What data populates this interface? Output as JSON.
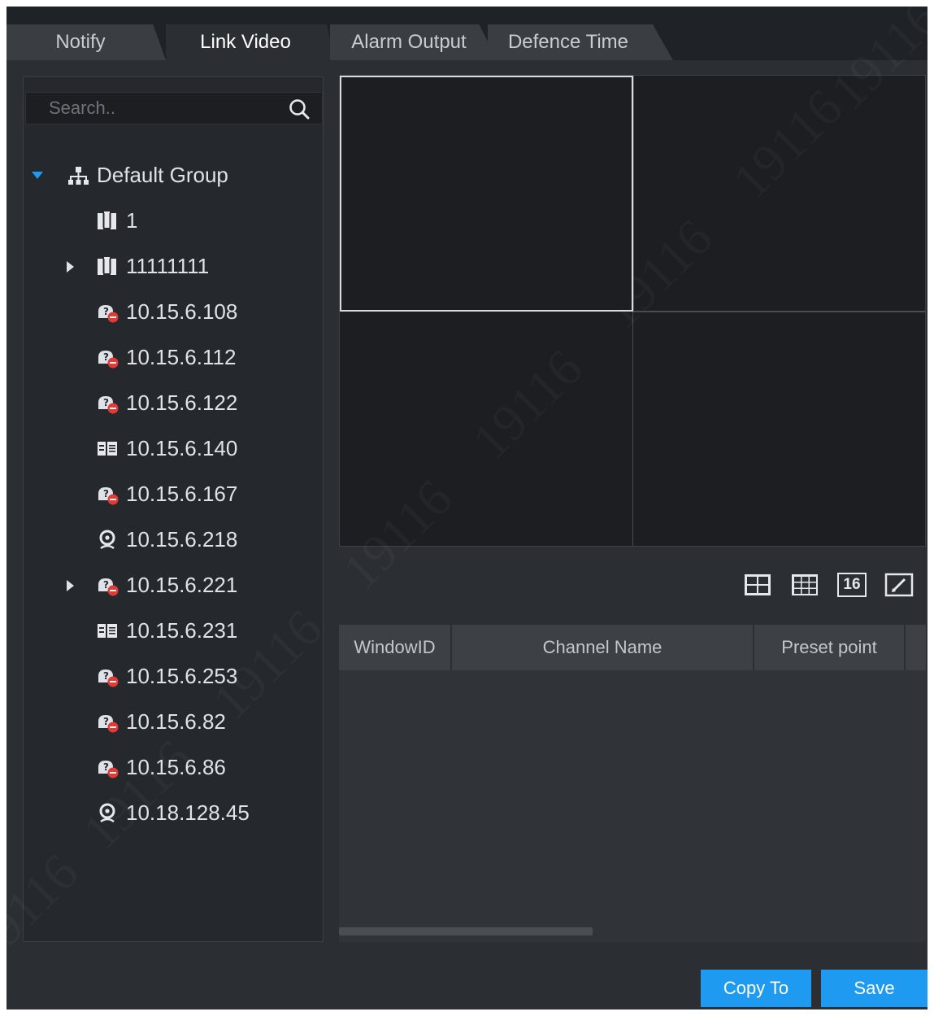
{
  "tabs": [
    {
      "label": "Notify",
      "active": false
    },
    {
      "label": "Link Video",
      "active": true
    },
    {
      "label": "Alarm Output",
      "active": false
    },
    {
      "label": "Defence Time",
      "active": false
    }
  ],
  "search": {
    "placeholder": "Search.."
  },
  "tree": {
    "group": {
      "label": "Default Group",
      "expanded": true,
      "icon": "group-icon"
    },
    "items": [
      {
        "label": "1",
        "icon": "map-icon",
        "has_children": false
      },
      {
        "label": "11111111",
        "icon": "map-icon",
        "has_children": true
      },
      {
        "label": "10.15.6.108",
        "icon": "offline-device-icon",
        "has_children": false
      },
      {
        "label": "10.15.6.112",
        "icon": "offline-device-icon",
        "has_children": false
      },
      {
        "label": "10.15.6.122",
        "icon": "offline-device-icon",
        "has_children": false
      },
      {
        "label": "10.15.6.140",
        "icon": "nvr-icon",
        "has_children": false
      },
      {
        "label": "10.15.6.167",
        "icon": "offline-device-icon",
        "has_children": false
      },
      {
        "label": "10.15.6.218",
        "icon": "camera-icon",
        "has_children": false
      },
      {
        "label": "10.15.6.221",
        "icon": "offline-device-icon",
        "has_children": true
      },
      {
        "label": "10.15.6.231",
        "icon": "nvr-icon",
        "has_children": false
      },
      {
        "label": "10.15.6.253",
        "icon": "offline-device-icon",
        "has_children": false
      },
      {
        "label": "10.15.6.82",
        "icon": "offline-device-icon",
        "has_children": false
      },
      {
        "label": "10.15.6.86",
        "icon": "offline-device-icon",
        "has_children": false
      },
      {
        "label": "10.18.128.45",
        "icon": "camera-icon",
        "has_children": false
      }
    ]
  },
  "layout_buttons": [
    {
      "icon": "layout-4-icon"
    },
    {
      "icon": "layout-9-icon"
    },
    {
      "icon": "layout-16-icon",
      "label": "16"
    },
    {
      "icon": "edit-icon"
    }
  ],
  "table": {
    "columns": [
      "WindowID",
      "Channel Name",
      "Preset point"
    ],
    "rows": []
  },
  "buttons": {
    "copy_to": "Copy To",
    "save": "Save"
  },
  "watermark_text": "19116",
  "colors": {
    "accent": "#1e9bf0",
    "background": "#2b2e33",
    "tab_bar": "#1f2226"
  }
}
